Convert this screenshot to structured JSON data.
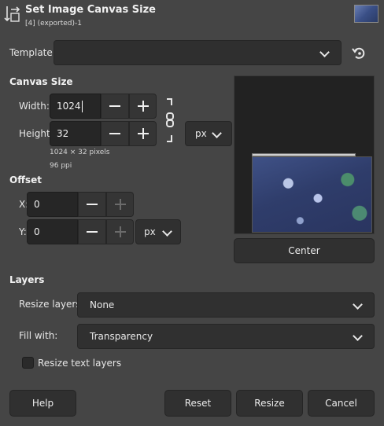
{
  "header": {
    "title": "Set Image Canvas Size",
    "subtitle": "[4] (exported)-1"
  },
  "template": {
    "label": "Template:",
    "value": ""
  },
  "canvas_size": {
    "heading": "Canvas Size",
    "width_label": "Width:",
    "width_value": "1024",
    "height_label": "Height:",
    "height_value": "32",
    "unit": "px",
    "info_size": "1024 × 32 pixels",
    "info_res": "96 ppi"
  },
  "offset": {
    "heading": "Offset",
    "x_label": "X:",
    "x_value": "0",
    "y_label": "Y:",
    "y_value": "0",
    "unit": "px"
  },
  "center_button": "Center",
  "layers": {
    "heading": "Layers",
    "resize_label": "Resize layers:",
    "resize_value": "None",
    "fill_label": "Fill with:",
    "fill_value": "Transparency",
    "resize_text_label": "Resize text layers"
  },
  "buttons": {
    "help": "Help",
    "reset": "Reset",
    "resize": "Resize",
    "cancel": "Cancel"
  },
  "icons": {
    "dialog": "canvas-size-icon",
    "reset_template": "reset-icon",
    "chain": "chain-icon"
  }
}
